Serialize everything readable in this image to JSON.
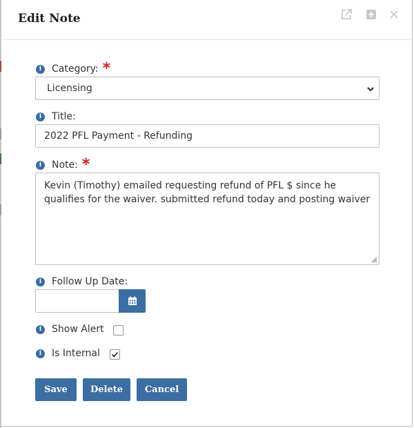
{
  "dialog": {
    "title": "Edit Note",
    "header_icons": [
      "external-link-icon",
      "expand-icon",
      "close-icon"
    ]
  },
  "form": {
    "category": {
      "label": "Category:",
      "required": true,
      "value": "Licensing"
    },
    "title": {
      "label": "Title:",
      "value": "2022 PFL Payment - Refunding"
    },
    "note": {
      "label": "Note:",
      "required": true,
      "value": "Kevin (Timothy) emailed requesting refund of PFL $ since he qualifies for the waiver. submitted refund today and posting waiver"
    },
    "follow_up_date": {
      "label": "Follow Up Date:",
      "value": ""
    },
    "show_alert": {
      "label": "Show Alert",
      "checked": false
    },
    "is_internal": {
      "label": "Is Internal",
      "checked": true
    },
    "required_marker": "*",
    "info_glyph": "i"
  },
  "actions": {
    "save": "Save",
    "delete": "Delete",
    "cancel": "Cancel"
  },
  "colors": {
    "primary": "#3b6ea3",
    "required": "#d21f1f",
    "info_icon": "#3a6c9f"
  }
}
